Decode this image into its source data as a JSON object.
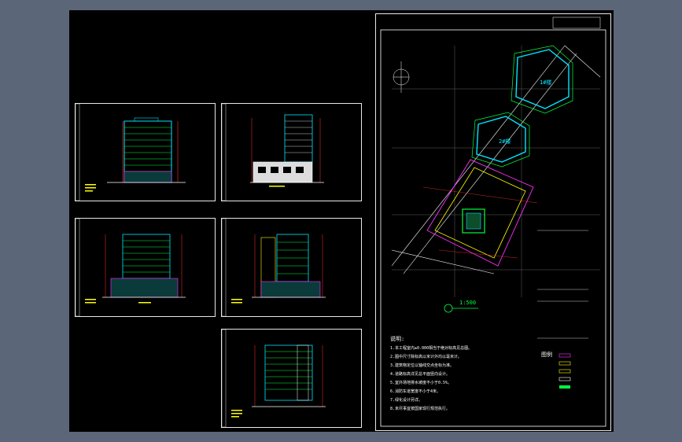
{
  "viewer": {
    "background": "#5b6678",
    "canvas_color": "#000000"
  },
  "site_plan": {
    "building_labels": [
      "1#楼",
      "2#楼"
    ],
    "scale_note": "1:500",
    "notes_title": "说明:",
    "notes": [
      "1.本工程室内±0.000相当于绝对标高见总图。",
      "2.图中尺寸除标高以米计外均以毫米计。",
      "3.建筑物定位以轴线交点坐标为准。",
      "4.道路标高详见总平面竖向设计。",
      "5.室外场地排水坡度不小于0.5%。",
      "6.消防车道宽度不小于4米。",
      "7.绿化设计另详。",
      "8.未尽事宜按国家现行规范执行。"
    ],
    "legend_title": "图例"
  },
  "colors": {
    "cyan": "#00e5ff",
    "green": "#00ff40",
    "magenta": "#ff30ff",
    "yellow": "#ffff00",
    "red": "#ff3030",
    "white": "#ffffff"
  }
}
